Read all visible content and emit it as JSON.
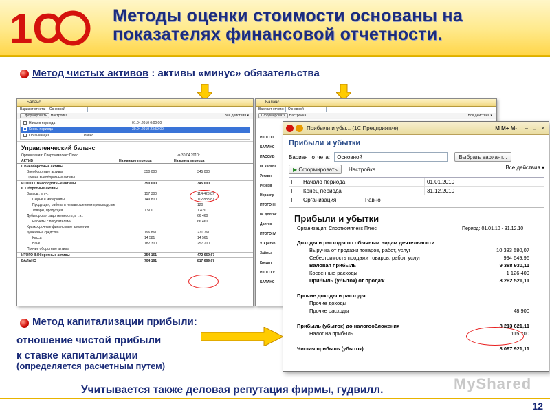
{
  "header": {
    "title": "Методы оценки стоимости основаны на показателях финансовой отчетности.",
    "logo": "1С"
  },
  "method1": {
    "label": "Метод чистых активов",
    "rest": " : активы «минус» обязательства"
  },
  "method2": {
    "label": "Метод капитализации прибыли",
    "colon": ":",
    "line1": "отношение чистой прибыли",
    "line2": "к ставке капитализации",
    "line3": "(определяется расчетным путем)"
  },
  "footer": {
    "note": "Учитывается также деловая репутация фирмы, гудвилл.",
    "page": "12",
    "watermark": "MyShared"
  },
  "win1": {
    "title": "Баланс",
    "variant_label": "Вариант отчета:",
    "variant": "Основной",
    "generate": "Сформировать",
    "settings": "Настройка...",
    "all_actions": "Все действия ▾",
    "params": [
      {
        "name": "Начало периода",
        "value": "01.04.2010 0:00:00"
      },
      {
        "name": "Конец периода",
        "value": "30.04.2010 23:59:00"
      },
      {
        "name": "Организация",
        "cmp": "Равно",
        "value": ""
      }
    ],
    "report": {
      "title": "Управленческий баланс",
      "org": "Организация: Спорткомплекс Плюс",
      "date": "на 30.04.2010г",
      "col_asset": "АКТИВ",
      "col_start": "На начало периода",
      "col_end": "На конец периода",
      "rows": [
        {
          "l": "I. Внеоборотные активы",
          "b": true
        },
        {
          "l": "Внеоборотные активы",
          "s": "350 000",
          "e": "345 000",
          "i": 1
        },
        {
          "l": "Прочие внеоборотные активы",
          "i": 1
        },
        {
          "l": "ИТОГО I. Внеоборотные активы",
          "s": "350 000",
          "e": "345 000",
          "b": true
        },
        {
          "l": "II. Оборотные активы",
          "b": true
        },
        {
          "l": "Запасы, в т.ч.:",
          "s": "157 300",
          "e": "114 428,87",
          "i": 1
        },
        {
          "l": "Сырье и материалы",
          "s": "149 800",
          "e": "112 888,87",
          "i": 2
        },
        {
          "l": "Продукция, работы в незавершенном производстве",
          "e": "120",
          "i": 2
        },
        {
          "l": "Товары, продукция",
          "s": "7 500",
          "e": "1 420",
          "i": 2
        },
        {
          "l": "Дебиторская задолженность, в т.ч.:",
          "e": "66 460",
          "i": 1
        },
        {
          "l": "Расчеты с покупателями",
          "e": "66 460",
          "i": 2
        },
        {
          "l": "Краткосрочные финансовые вложения",
          "i": 1
        },
        {
          "l": "Денежные средства",
          "s": "196 861",
          "e": "271 761",
          "i": 1
        },
        {
          "l": "Касса",
          "s": "14 581",
          "e": "14 561",
          "i": 2
        },
        {
          "l": "Банк",
          "s": "182 300",
          "e": "257 200",
          "i": 2
        },
        {
          "l": "Прочие оборотные активы",
          "i": 1
        },
        {
          "l": "ИТОГО II.Оборотные активы",
          "s": "354 161",
          "e": "472 669,67",
          "b": true
        },
        {
          "l": "БАЛАНС",
          "s": "704 161",
          "e": "817 669,67",
          "b": true
        }
      ]
    }
  },
  "win2": {
    "title": "Баланс",
    "variant_label": "Вариант отчета:",
    "variant": "Основной",
    "generate": "Сформировать",
    "settings": "Настройка...",
    "all_actions": "Все действия ▾",
    "side": [
      "ИТОГО II.",
      "БАЛАНС",
      "ПАССИВ",
      "III. Капита",
      "Уставн",
      "Резерв",
      "Нераспр",
      "ИТОГО III.",
      "IV. Долгос",
      "Долгос",
      "ИТОГО IV.",
      "V. Кратко",
      "Займы",
      "Кредит",
      "ИТОГО V.",
      "БАЛАНС"
    ]
  },
  "win3": {
    "app_title": "Прибыли и убы... (1С:Предприятие)",
    "toolbar_right": "M  M+  M-",
    "heading": "Прибыли и убытки",
    "variant_label": "Вариант отчета:",
    "variant": "Основной",
    "choose_variant": "Выбрать вариант...",
    "generate": "Сформировать",
    "settings": "Настройка...",
    "all_actions": "Все действия ▾",
    "params": [
      {
        "name": "Начало периода",
        "value": "01.01.2010"
      },
      {
        "name": "Конец периода",
        "value": "31.12.2010"
      },
      {
        "name": "Организация",
        "cmp": "Равно",
        "value": ""
      }
    ],
    "report": {
      "title": "Прибыли и убытки",
      "org": "Организация: Спорткомплекс Плюс",
      "period": "Период: 01.01.10 - 31.12.10",
      "rows": [
        {
          "l": "Доходы и расходы по обычным видам деятельности",
          "b": true
        },
        {
          "l": "Выручка от продажи товаров, работ, услуг",
          "v": "10 383 580,07",
          "i": 1
        },
        {
          "l": "Себестоимость продажи товаров, работ, услуг",
          "v": "994 649,96",
          "i": 1
        },
        {
          "l": "Валовая прибыль",
          "v": "9 388 930,11",
          "i": 1,
          "b": true
        },
        {
          "l": "Косвенные расходы",
          "v": "1 126 409",
          "i": 1
        },
        {
          "l": "Прибыль (убыток) от продаж",
          "v": "8 262 521,11",
          "i": 1,
          "b": true
        },
        {
          "l": "",
          "v": ""
        },
        {
          "l": "Прочие доходы и расходы",
          "b": true
        },
        {
          "l": "Прочие доходы",
          "v": "",
          "i": 1
        },
        {
          "l": "Прочие расходы",
          "v": "48 900",
          "i": 1
        },
        {
          "l": "",
          "v": ""
        },
        {
          "l": "Прибыль (убыток) до налогообложения",
          "v": "8 213 621,11",
          "b": true
        },
        {
          "l": "Налог на прибыль",
          "v": "115 700",
          "i": 1
        },
        {
          "l": "",
          "v": ""
        },
        {
          "l": "Чистая прибыль (убыток)",
          "v": "8 097 921,11",
          "b": true
        }
      ]
    }
  },
  "colors": {
    "title": "#1c2c7c",
    "accent_red": "#d4120c",
    "arrow": "#ffcc00",
    "ellipse": "#e82020"
  }
}
